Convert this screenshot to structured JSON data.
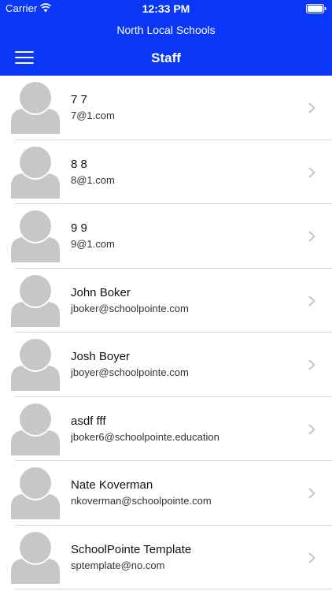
{
  "status_bar": {
    "carrier": "Carrier",
    "time": "12:33 PM"
  },
  "header": {
    "org_name": "North Local Schools",
    "title": "Staff",
    "menu_icon": "hamburger-menu-icon",
    "background_color": "#0a36f5"
  },
  "staff": [
    {
      "name": "7 7",
      "email": "7@1.com"
    },
    {
      "name": "8 8",
      "email": "8@1.com"
    },
    {
      "name": "9 9",
      "email": "9@1.com"
    },
    {
      "name": "John Boker",
      "email": "jboker@schoolpointe.com"
    },
    {
      "name": "Josh Boyer",
      "email": "jboyer@schoolpointe.com"
    },
    {
      "name": "asdf fff",
      "email": "jboker6@schoolpointe.education"
    },
    {
      "name": "Nate Koverman",
      "email": "nkoverman@schoolpointe.com"
    },
    {
      "name": "SchoolPointe Template",
      "email": "sptemplate@no.com"
    }
  ],
  "icons": {
    "avatar": "person-placeholder-icon",
    "row_action": "chevron-right-icon"
  }
}
